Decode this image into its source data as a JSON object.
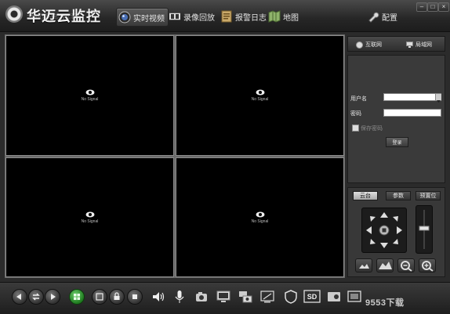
{
  "app": {
    "title": "华迈云监控"
  },
  "nav": [
    {
      "label": "实时视频",
      "icon": "camera-lens-icon",
      "active": true
    },
    {
      "label": "录像回放",
      "icon": "film-strip-icon",
      "active": false
    },
    {
      "label": "报警日志",
      "icon": "alarm-log-icon",
      "active": false
    },
    {
      "label": "地图",
      "icon": "map-icon",
      "active": false
    }
  ],
  "config": {
    "label": "配置",
    "icon": "wrench-icon"
  },
  "window_controls": [
    "minimize-icon",
    "maximize-icon",
    "close-icon"
  ],
  "video": {
    "panes": [
      {
        "status": "No Signal"
      },
      {
        "status": "No Signal"
      },
      {
        "status": "No Signal"
      },
      {
        "status": "No Signal"
      }
    ]
  },
  "net_tabs": [
    {
      "label": "互联网",
      "icon": "globe-icon"
    },
    {
      "label": "局域网",
      "icon": "lan-icon"
    }
  ],
  "login": {
    "username_label": "用户名",
    "username_value": "",
    "password_label": "密码",
    "password_value": "",
    "remember_label": "保存密码",
    "remember_checked": false,
    "submit_label": "登录"
  },
  "ptz": {
    "tabs": [
      "云台",
      "参数",
      "预置位"
    ],
    "active_tab": "云台"
  },
  "toolbar": {
    "icons": [
      "back-icon",
      "refresh-icon",
      "forward-icon",
      "grid-layout-icon",
      "fullscreen-icon",
      "lock-icon",
      "stop-icon",
      "speaker-icon",
      "microphone-icon",
      "snapshot-icon",
      "monitor-icon",
      "multi-camera-icon",
      "screen-record-icon",
      "shield-icon",
      "sd-icon",
      "storage-icon",
      "panel-icon"
    ],
    "sd_label": "SD"
  },
  "watermark": "9553下载"
}
